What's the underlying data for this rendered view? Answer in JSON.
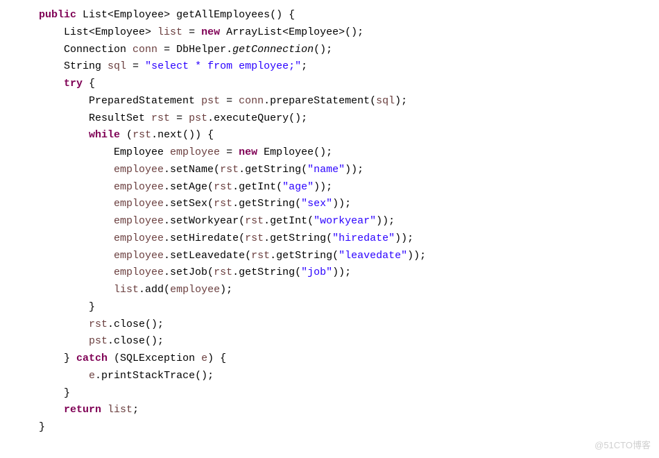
{
  "code": {
    "l1": {
      "ind": "    ",
      "k1": "public",
      "sp1": " ",
      "t1": "List<Employee> getAllEmployees() {"
    },
    "l2": {
      "ind": "        ",
      "t1": "List<Employee> ",
      "v1": "list",
      "t2": " = ",
      "k1": "new",
      "t3": " ArrayList<Employee>();"
    },
    "l3": {
      "ind": "        ",
      "t1": "Connection ",
      "v1": "conn",
      "t2": " = DbHelper.",
      "m1": "getConnection",
      "t3": "();"
    },
    "l4": {
      "ind": "        ",
      "t1": "String ",
      "v1": "sql",
      "t2": " = ",
      "s1": "\"select * from employee;\"",
      "t3": ";"
    },
    "l5": {
      "ind": "        ",
      "k1": "try",
      "t1": " {"
    },
    "l6": {
      "ind": "            ",
      "t1": "PreparedStatement ",
      "v1": "pst",
      "t2": " = ",
      "v2": "conn",
      "t3": ".prepareStatement(",
      "v3": "sql",
      "t4": ");"
    },
    "l7": {
      "ind": "            ",
      "t1": "ResultSet ",
      "v1": "rst",
      "t2": " = ",
      "v2": "pst",
      "t3": ".executeQuery();"
    },
    "l8": {
      "ind": "            ",
      "k1": "while",
      "t1": " (",
      "v1": "rst",
      "t2": ".next()) {"
    },
    "l9": {
      "ind": "                ",
      "t1": "Employee ",
      "v1": "employee",
      "t2": " = ",
      "k1": "new",
      "t3": " Employee();"
    },
    "l10": {
      "ind": "                ",
      "v1": "employee",
      "t1": ".setName(",
      "v2": "rst",
      "t2": ".getString(",
      "s1": "\"name\"",
      "t3": "));"
    },
    "l11": {
      "ind": "                ",
      "v1": "employee",
      "t1": ".setAge(",
      "v2": "rst",
      "t2": ".getInt(",
      "s1": "\"age\"",
      "t3": "));"
    },
    "l12": {
      "ind": "                ",
      "v1": "employee",
      "t1": ".setSex(",
      "v2": "rst",
      "t2": ".getString(",
      "s1": "\"sex\"",
      "t3": "));"
    },
    "l13": {
      "ind": "                ",
      "v1": "employee",
      "t1": ".setWorkyear(",
      "v2": "rst",
      "t2": ".getInt(",
      "s1": "\"workyear\"",
      "t3": "));"
    },
    "l14": {
      "ind": "                ",
      "v1": "employee",
      "t1": ".setHiredate(",
      "v2": "rst",
      "t2": ".getString(",
      "s1": "\"hiredate\"",
      "t3": "));"
    },
    "l15": {
      "ind": "                ",
      "v1": "employee",
      "t1": ".setLeavedate(",
      "v2": "rst",
      "t2": ".getString(",
      "s1": "\"leavedate\"",
      "t3": "));"
    },
    "l16": {
      "ind": "                ",
      "v1": "employee",
      "t1": ".setJob(",
      "v2": "rst",
      "t2": ".getString(",
      "s1": "\"job\"",
      "t3": "));"
    },
    "l17": {
      "ind": "                ",
      "v1": "list",
      "t1": ".add(",
      "v2": "employee",
      "t2": ");"
    },
    "l18": {
      "ind": "            ",
      "t1": "}"
    },
    "l19": {
      "ind": "            ",
      "v1": "rst",
      "t1": ".close();"
    },
    "l20": {
      "ind": "            ",
      "v1": "pst",
      "t1": ".close();"
    },
    "l21": {
      "ind": "        ",
      "t1": "} ",
      "k1": "catch",
      "t2": " (SQLException ",
      "v1": "e",
      "t3": ") {"
    },
    "l22": {
      "ind": "            ",
      "v1": "e",
      "t1": ".printStackTrace();"
    },
    "l23": {
      "ind": "        ",
      "t1": "}"
    },
    "l24": {
      "ind": "        ",
      "k1": "return",
      "t1": " ",
      "v1": "list",
      "t2": ";"
    },
    "l25": {
      "ind": "    ",
      "t1": "}"
    }
  },
  "watermark": "@51CTO博客"
}
